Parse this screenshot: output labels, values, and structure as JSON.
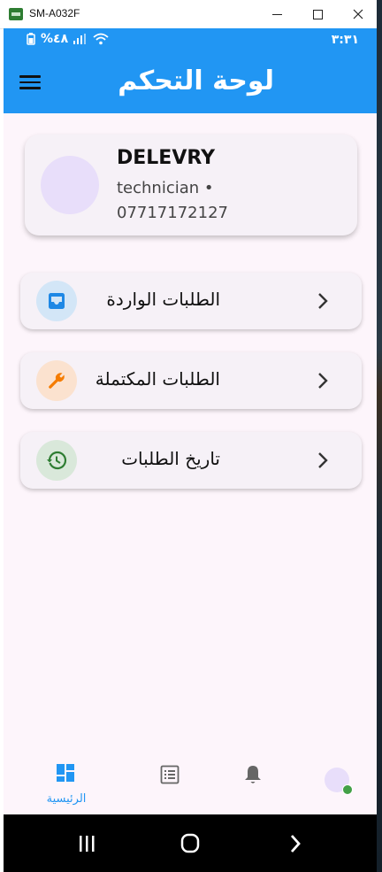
{
  "window": {
    "title": "SM-A032F"
  },
  "status_bar": {
    "battery": "%٤٨",
    "time": "٣:٣١"
  },
  "app_bar": {
    "title": "لوحة التحكم"
  },
  "profile": {
    "name": "DELEVRY",
    "role": "technician •",
    "phone": "07717172127"
  },
  "menu": [
    {
      "label": "الطلبات الواردة",
      "icon": "inbox-icon",
      "icon_color": "#1e88e5",
      "icon_bg": "#d3e6f7"
    },
    {
      "label": "الطلبات المكتملة",
      "icon": "wrench-icon",
      "icon_color": "#f57c00",
      "icon_bg": "#fbe2cf"
    },
    {
      "label": "تاريخ الطلبات",
      "icon": "history-icon",
      "icon_color": "#2e7d32",
      "icon_bg": "#d9e8da"
    }
  ],
  "bottom_nav": {
    "home_label": "الرئيسية",
    "active_color": "#2196f3"
  },
  "colors": {
    "primary": "#2196f3",
    "background": "#fdf5fb",
    "card": "#f6f1f7"
  }
}
